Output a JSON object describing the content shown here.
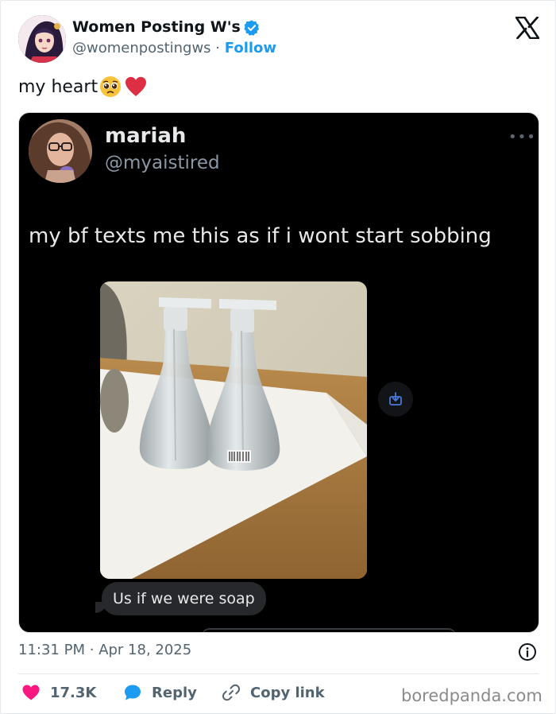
{
  "author": {
    "name": "Women Posting W's",
    "handle": "@womenpostingws",
    "separator": "·",
    "follow_label": "Follow"
  },
  "tweet": {
    "text": "my heart",
    "emojis": [
      "pleading-face-emoji",
      "red-heart-emoji"
    ]
  },
  "embedded": {
    "name": "mariah",
    "handle": "@myaistired",
    "more": "•••",
    "text": "my bf texts me this as if i wont start sobbing",
    "message_bubble": "Us if we were soap"
  },
  "footer": {
    "time": "11:31 PM",
    "date_separator": "·",
    "date": "Apr 18, 2025",
    "likes": "17.3K",
    "reply_label": "Reply",
    "copy_link_label": "Copy link",
    "watermark": "boredpanda.com"
  },
  "colors": {
    "accent": "#1d9bf0",
    "like": "#f91880",
    "text": "#0f1419",
    "muted": "#536471"
  },
  "icons": [
    "verified-badge-icon",
    "x-logo-icon",
    "download-icon",
    "info-icon",
    "heart-icon",
    "reply-bubble-icon",
    "link-icon"
  ]
}
